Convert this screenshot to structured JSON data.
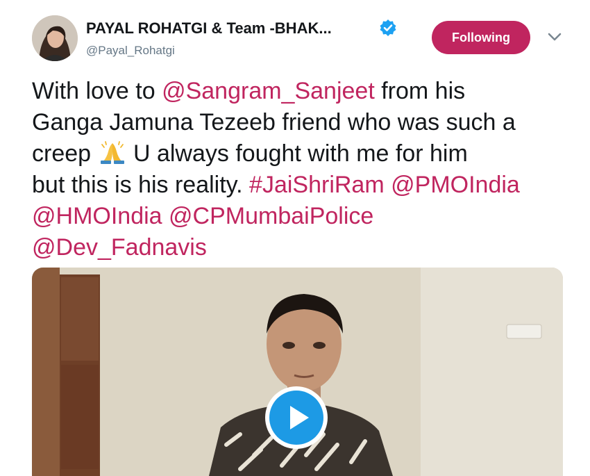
{
  "author": {
    "display_name": "PAYAL ROHATGI & Team -BHAK...",
    "handle": "@Payal_Rohatgi",
    "verified": true
  },
  "follow_button": {
    "label": "Following",
    "color": "#c0255f"
  },
  "tweet": {
    "lines": [
      [
        {
          "text": "With love to ",
          "link": false
        },
        {
          "text": "@Sangram_Sanjeet",
          "link": true
        },
        {
          "text": " from his",
          "link": false
        }
      ],
      [
        {
          "text": "Ganga Jamuna Tezeeb friend who was such a",
          "link": false
        }
      ],
      [
        {
          "text": "creep ",
          "link": false
        },
        {
          "emoji": "folded-hands"
        },
        {
          "text": " U always fought with me for him",
          "link": false
        }
      ],
      [
        {
          "text": "but this is his reality. ",
          "link": false
        },
        {
          "text": "#JaiShriRam",
          "link": true
        },
        {
          "text": " ",
          "link": false
        },
        {
          "text": "@PMOIndia",
          "link": true
        }
      ],
      [
        {
          "text": "@HMOIndia",
          "link": true
        },
        {
          "text": " ",
          "link": false
        },
        {
          "text": "@CPMumbaiPolice",
          "link": true
        }
      ],
      [
        {
          "text": "@Dev_Fadnavis",
          "link": true
        }
      ]
    ]
  },
  "media": {
    "type": "video",
    "play_icon": "play-icon",
    "accent": "#1d9ae5"
  },
  "icons": {
    "verified": "verified-badge-icon",
    "caret": "chevron-down-icon"
  }
}
